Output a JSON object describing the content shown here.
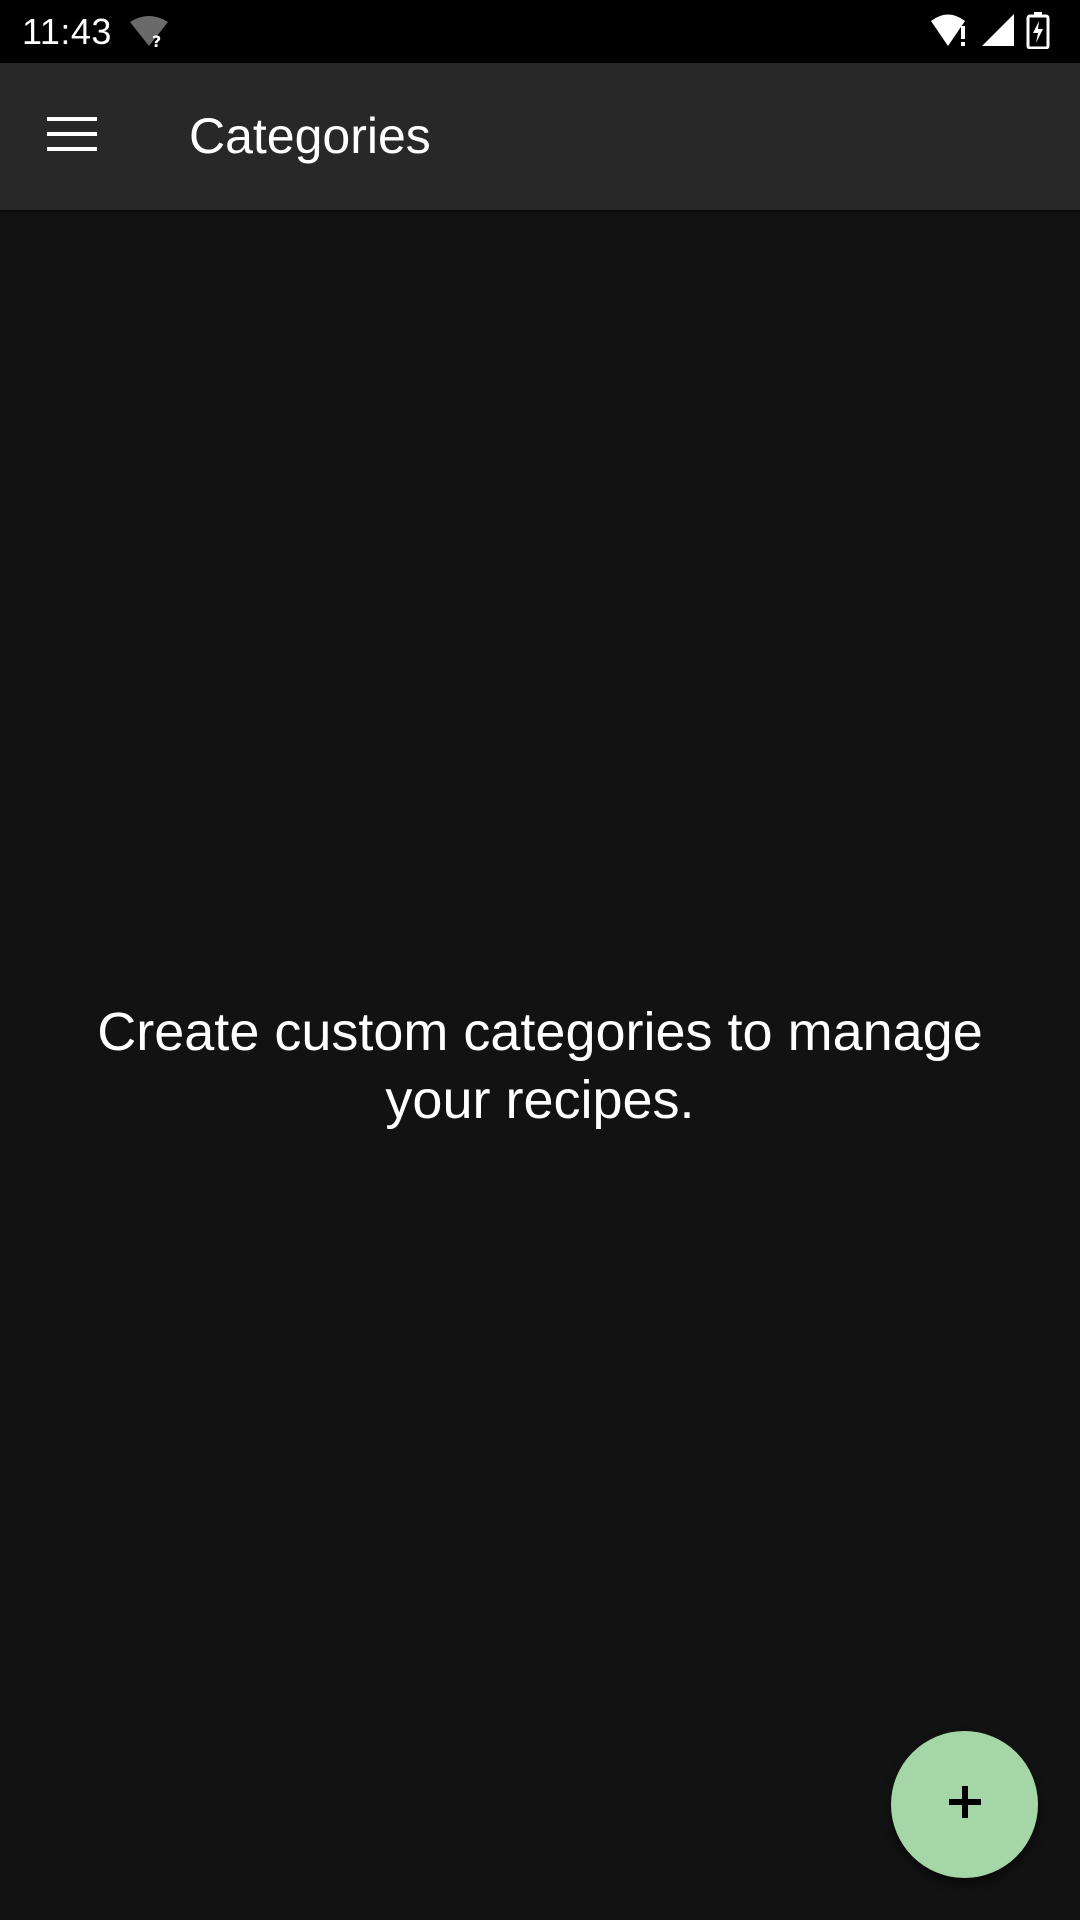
{
  "status_bar": {
    "time": "11:43",
    "icons": [
      "wifi-unknown-icon",
      "wifi-alert-icon",
      "cellular-signal-icon",
      "battery-charging-icon"
    ]
  },
  "app_bar": {
    "title": "Categories",
    "menu_icon": "hamburger-menu-icon"
  },
  "empty_state": {
    "message": "Create custom categories to manage your recipes."
  },
  "fab": {
    "icon": "plus-icon",
    "color": "#a5d6a7"
  },
  "colors": {
    "background": "#121212",
    "app_bar": "#282828",
    "status_bar": "#000000",
    "text": "#ffffff"
  }
}
